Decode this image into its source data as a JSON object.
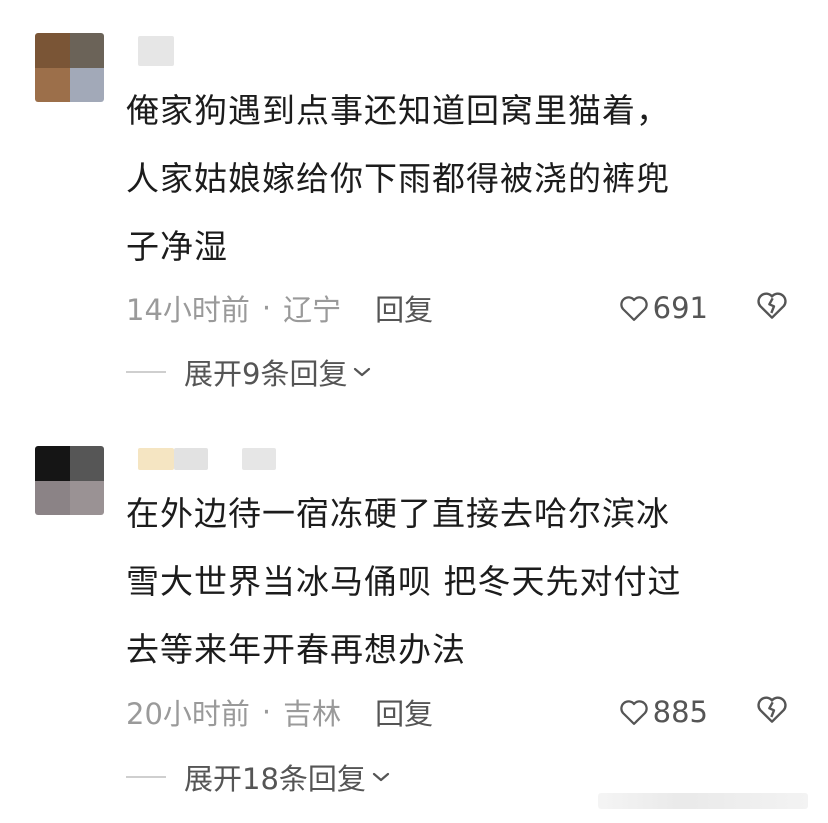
{
  "comments": [
    {
      "avatar_colors": [
        "#7a5536",
        "#6b6358",
        "#9c6f4a",
        "#a2a9b8"
      ],
      "name_blur_colors": [
        "#e6e6e6"
      ],
      "lines": [
        "俺家狗遇到点事还知道回窝里猫着，",
        "人家姑娘嫁给你下雨都得被浇的裤兜",
        "子净湿"
      ],
      "time": "14小时前",
      "separator": "·",
      "location": "辽宁",
      "reply_label": "回复",
      "likes": "691",
      "expand_label": "展开9条回复"
    },
    {
      "avatar_colors": [
        "#151515",
        "#565656",
        "#8b8386",
        "#9a9294"
      ],
      "name_blur_colors": [
        "#f5e5c2",
        "#e2e2e2",
        "#e6e6e6"
      ],
      "lines": [
        "在外边待一宿冻硬了直接去哈尔滨冰",
        "雪大世界当冰马俑呗 把冬天先对付过",
        "去等来年开春再想办法"
      ],
      "time": "20小时前",
      "separator": "·",
      "location": "吉林",
      "reply_label": "回复",
      "likes": "885",
      "expand_label": "展开18条回复"
    }
  ],
  "icons": {
    "like": "heart-outline-icon",
    "unlike": "broken-heart-icon",
    "expand": "chevron-down-icon"
  },
  "colors": {
    "meta_gray": "#9a9a9a",
    "action_gray": "#555555",
    "text": "#1c1c1c"
  }
}
